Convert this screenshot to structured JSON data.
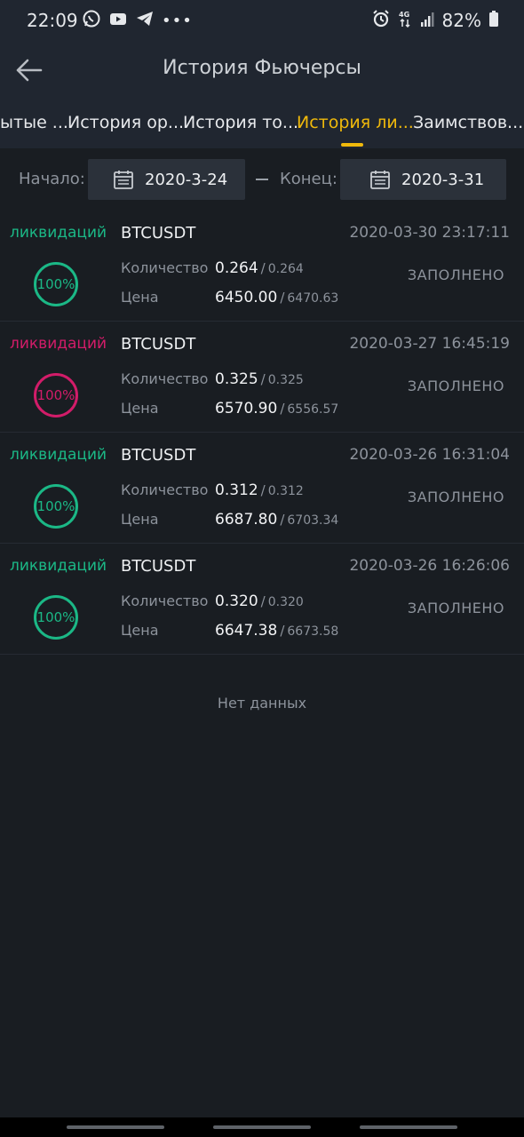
{
  "status_bar": {
    "time": "22:09",
    "battery": "82%",
    "left_icons": [
      "whatsapp-icon",
      "youtube-icon",
      "telegram-icon",
      "more-dots-icon"
    ],
    "right_icons": [
      "alarm-icon",
      "4g-icon",
      "signal-icon",
      "battery-icon"
    ]
  },
  "header": {
    "title": "История Фьючерсы"
  },
  "tabs": [
    {
      "label": "ытые ...",
      "active": false
    },
    {
      "label": "История ор...",
      "active": false
    },
    {
      "label": "История то...",
      "active": false
    },
    {
      "label": "История ли...",
      "active": true
    },
    {
      "label": "Заимствов...",
      "active": false
    }
  ],
  "filter": {
    "start_label": "Начало:",
    "start_date": "2020-3-24",
    "end_label": "Конец:",
    "end_date": "2020-3-31"
  },
  "records": [
    {
      "type": "ликвидаций",
      "color": "#1bb886",
      "percent": "100%",
      "symbol": "BTCUSDT",
      "time": "2020-03-30 23:17:11",
      "qty_label": "Количество",
      "qty": "0.264",
      "qty_total": "0.264",
      "price_label": "Цена",
      "price": "6450.00",
      "price_ref": "6470.63",
      "status": "ЗАПОЛНЕНО"
    },
    {
      "type": "ликвидаций",
      "color": "#d21c69",
      "percent": "100%",
      "symbol": "BTCUSDT",
      "time": "2020-03-27 16:45:19",
      "qty_label": "Количество",
      "qty": "0.325",
      "qty_total": "0.325",
      "price_label": "Цена",
      "price": "6570.90",
      "price_ref": "6556.57",
      "status": "ЗАПОЛНЕНО"
    },
    {
      "type": "ликвидаций",
      "color": "#1bb886",
      "percent": "100%",
      "symbol": "BTCUSDT",
      "time": "2020-03-26 16:31:04",
      "qty_label": "Количество",
      "qty": "0.312",
      "qty_total": "0.312",
      "price_label": "Цена",
      "price": "6687.80",
      "price_ref": "6703.34",
      "status": "ЗАПОЛНЕНО"
    },
    {
      "type": "ликвидаций",
      "color": "#1bb886",
      "percent": "100%",
      "symbol": "BTCUSDT",
      "time": "2020-03-26 16:26:06",
      "qty_label": "Количество",
      "qty": "0.320",
      "qty_total": "0.320",
      "price_label": "Цена",
      "price": "6647.38",
      "price_ref": "6673.58",
      "status": "ЗАПОЛНЕНО"
    }
  ],
  "empty_text": "Нет данных",
  "colors": {
    "accent": "#f0b90b",
    "buy": "#1bb886",
    "sell": "#d21c69",
    "background": "#191d22"
  }
}
